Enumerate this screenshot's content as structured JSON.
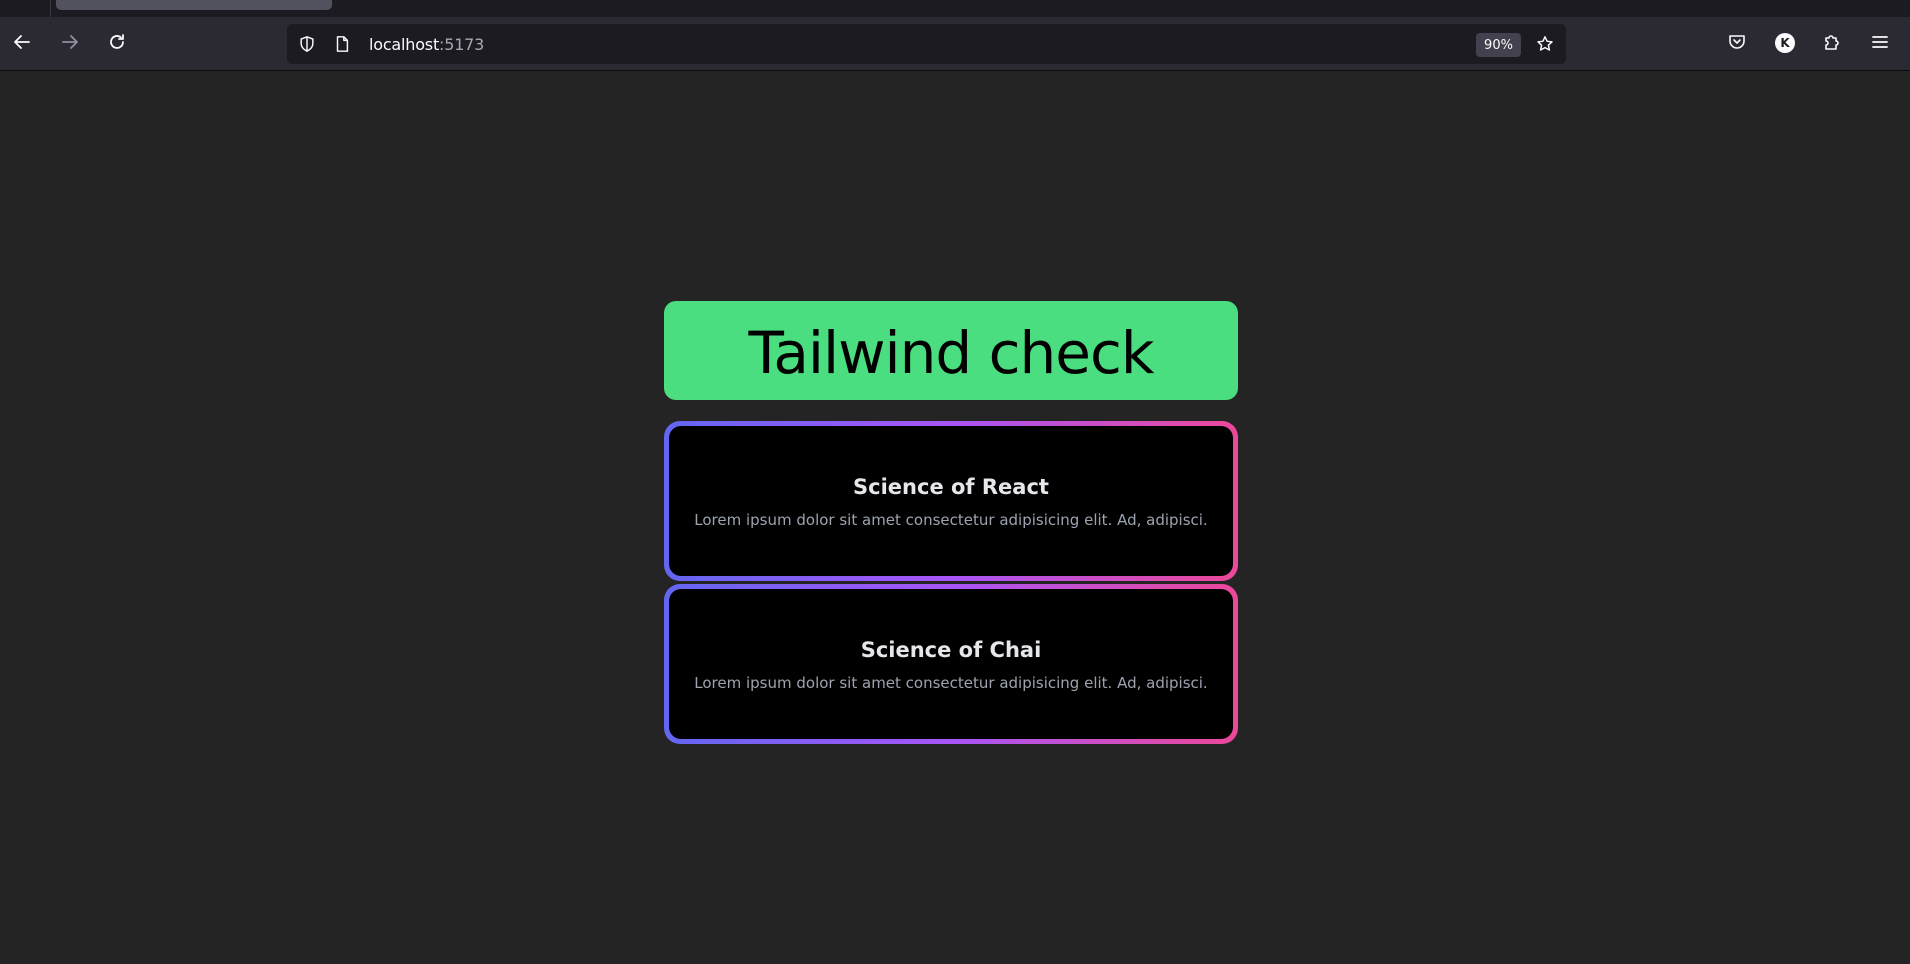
{
  "browser": {
    "url_host": "localhost",
    "url_port": ":5173",
    "zoom": "90%",
    "account_initial": "K"
  },
  "page": {
    "hero_title": "Tailwind check",
    "cards": [
      {
        "title": "Science of React",
        "body": "Lorem ipsum dolor sit amet consectetur adipisicing elit. Ad, adipisci."
      },
      {
        "title": "Science of Chai",
        "body": "Lorem ipsum dolor sit amet consectetur adipisicing elit. Ad, adipisci."
      }
    ]
  },
  "colors": {
    "page_bg": "#242424",
    "hero_bg": "#4ade80",
    "card_bg": "#000000",
    "gradient_start": "#6366f1",
    "gradient_mid": "#a855f7",
    "gradient_end": "#ec4899"
  }
}
